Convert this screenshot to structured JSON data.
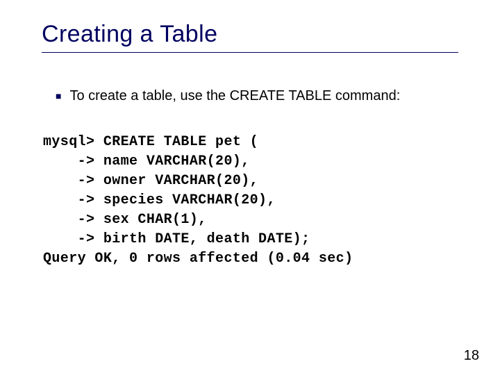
{
  "slide": {
    "title": "Creating a Table",
    "bullet": {
      "text": "To create a table, use the CREATE TABLE command:"
    },
    "code": "mysql> CREATE TABLE pet (\n    -> name VARCHAR(20),\n    -> owner VARCHAR(20),\n    -> species VARCHAR(20),\n    -> sex CHAR(1),\n    -> birth DATE, death DATE);\nQuery OK, 0 rows affected (0.04 sec)",
    "page_number": "18"
  }
}
